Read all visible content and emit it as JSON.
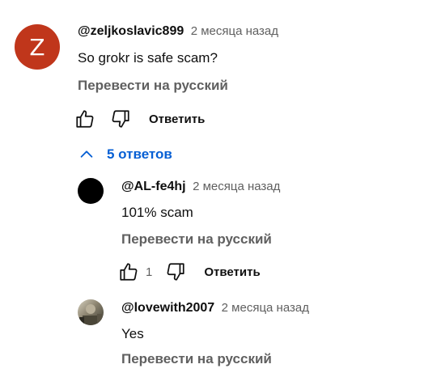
{
  "comment": {
    "avatar_letter": "Z",
    "author": "@zeljkoslavic899",
    "time": "2 месяца назад",
    "text": "So grokr is safe scam?",
    "translate": "Перевести на русский",
    "reply_label": "Ответить",
    "replies_toggle": "5 ответов"
  },
  "replies": [
    {
      "author": "@AL-fe4hj",
      "time": "2 месяца назад",
      "text": "101% scam",
      "translate": "Перевести на русский",
      "likes": "1",
      "reply_label": "Ответить"
    },
    {
      "author": "@lovewith2007",
      "time": "2 месяца назад",
      "text": "Yes",
      "translate": "Перевести на русский"
    }
  ],
  "colors": {
    "link_blue": "#065fd4",
    "secondary_text": "#606060",
    "avatar_red": "#c0361b"
  }
}
